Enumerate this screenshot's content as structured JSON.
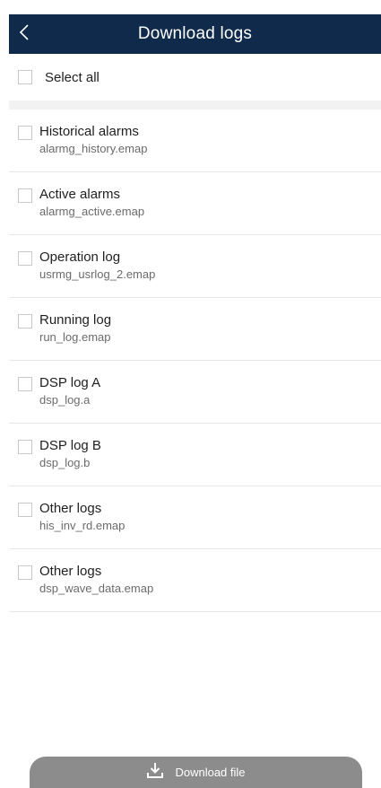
{
  "header": {
    "title": "Download logs",
    "back_icon": "chevron-left-icon"
  },
  "select_all": {
    "label": "Select all",
    "checked": false
  },
  "logs": [
    {
      "name": "Historical alarms",
      "file": "alarmg_history.emap",
      "checked": false
    },
    {
      "name": "Active alarms",
      "file": "alarmg_active.emap",
      "checked": false
    },
    {
      "name": "Operation log",
      "file": "usrmg_usrlog_2.emap",
      "checked": false
    },
    {
      "name": "Running log",
      "file": "run_log.emap",
      "checked": false
    },
    {
      "name": "DSP log A",
      "file": "dsp_log.a",
      "checked": false
    },
    {
      "name": "DSP log B",
      "file": "dsp_log.b",
      "checked": false
    },
    {
      "name": "Other logs",
      "file": "his_inv_rd.emap",
      "checked": false
    },
    {
      "name": "Other logs",
      "file": "dsp_wave_data.emap",
      "checked": false
    }
  ],
  "download_button": {
    "label": "Download file",
    "icon": "download-icon"
  },
  "colors": {
    "header_bg": "#0f2a4a",
    "button_bg": "#8c8c8c"
  }
}
